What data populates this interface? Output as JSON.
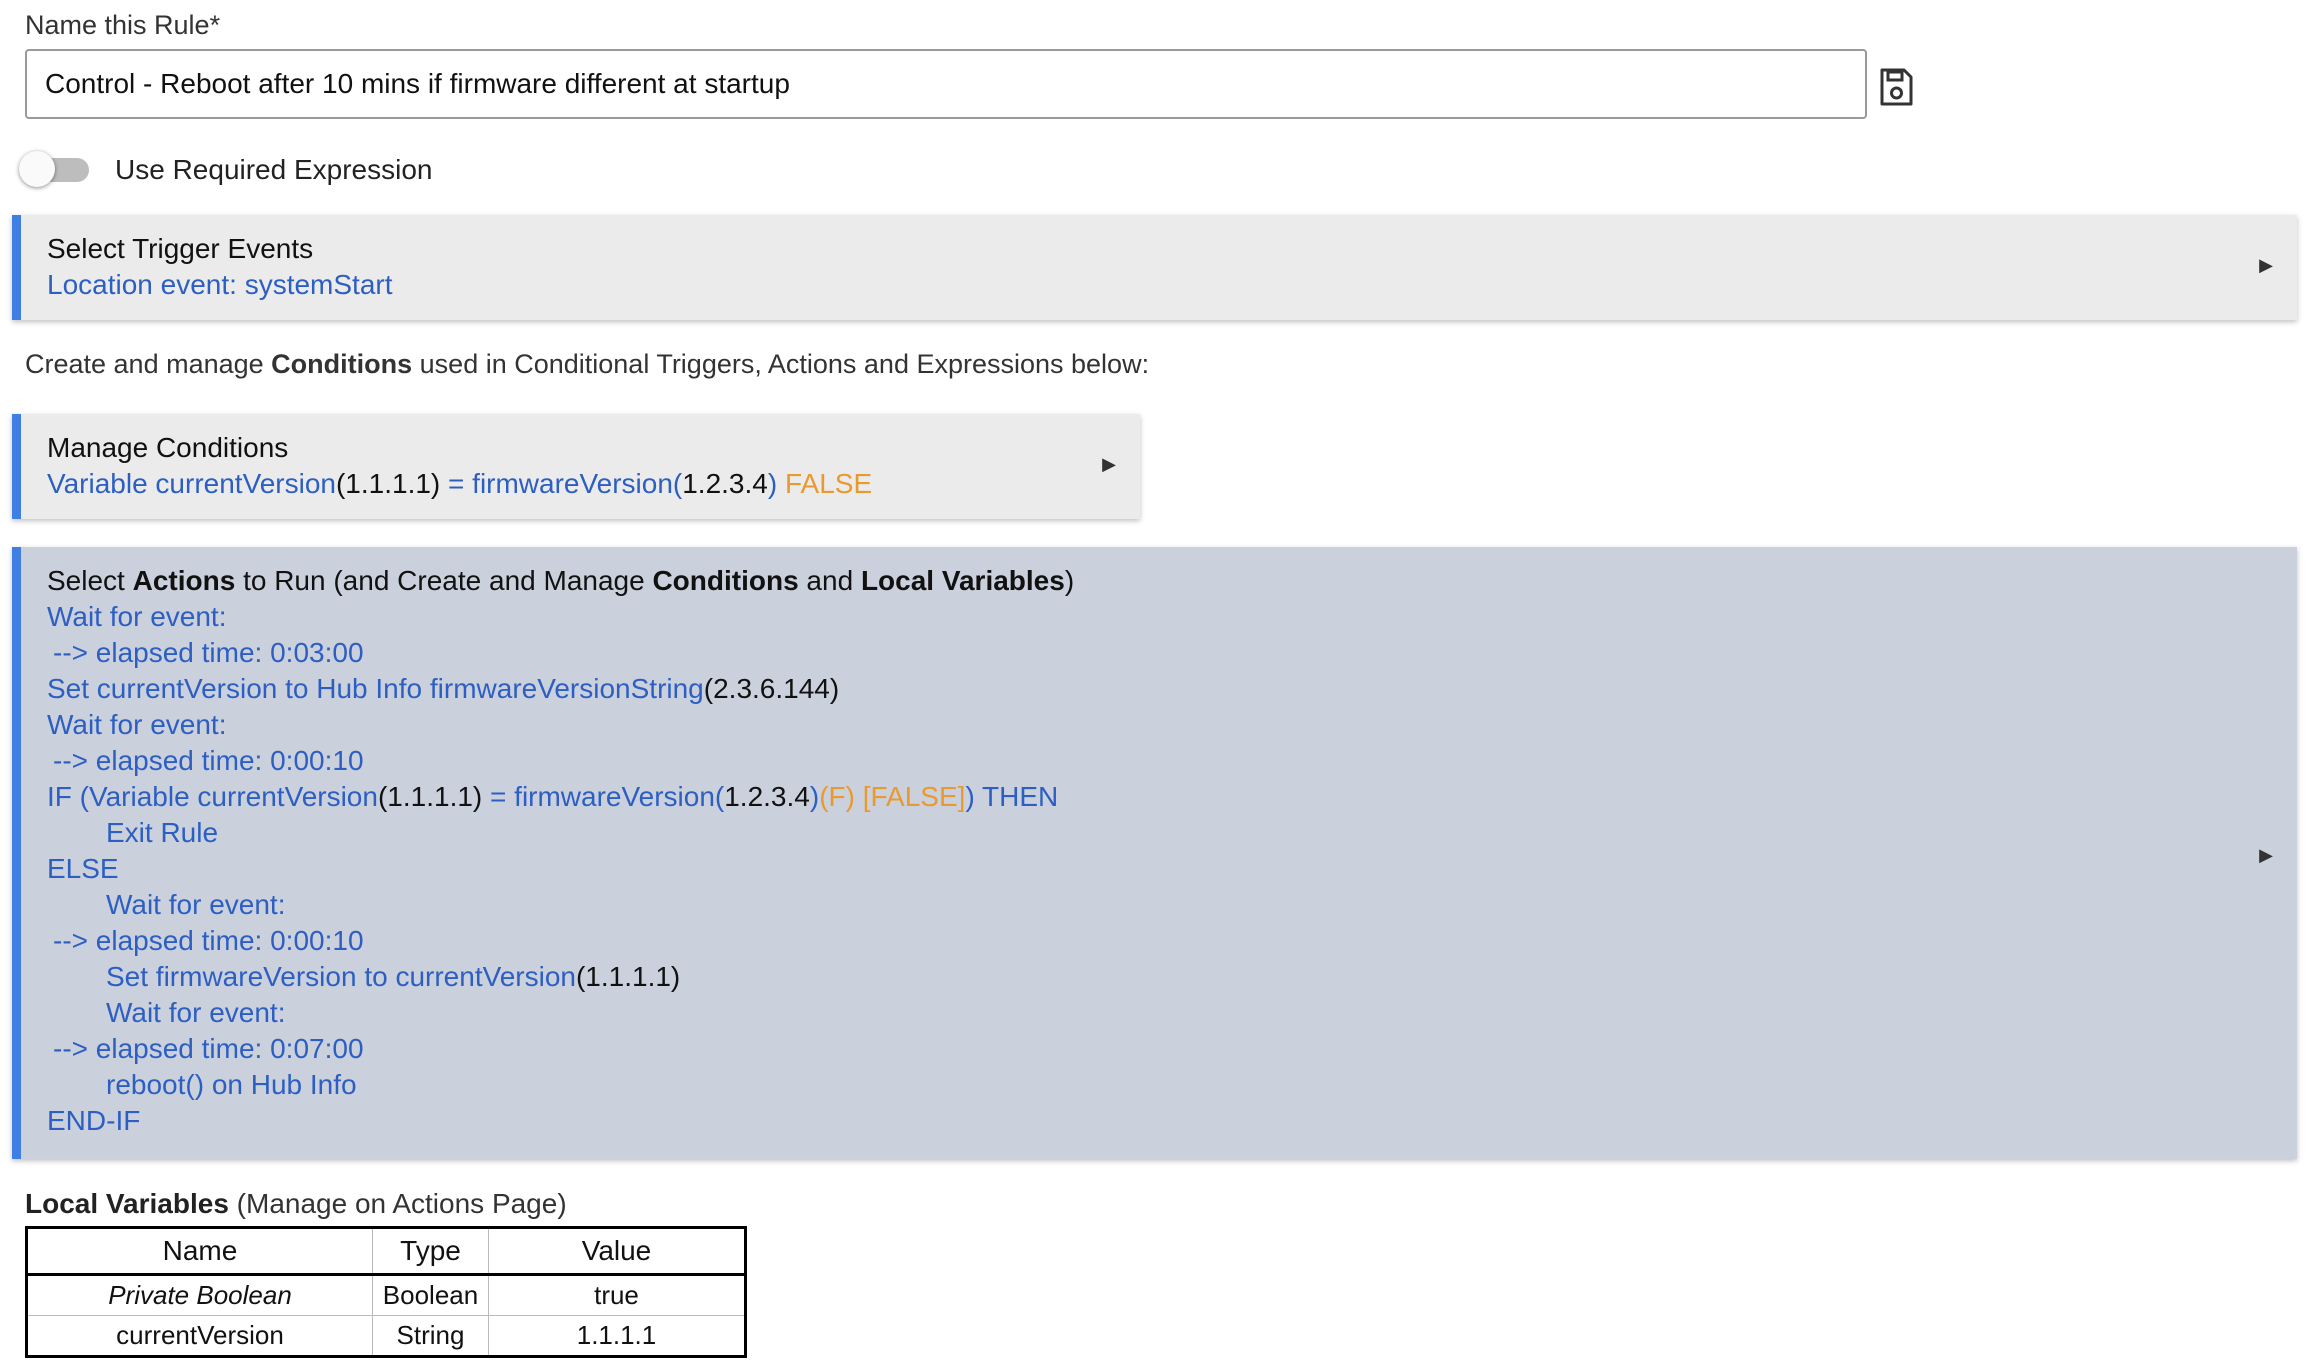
{
  "rule_name": {
    "label": "Name this Rule*",
    "value": "Control - Reboot after 10 mins if firmware different at startup"
  },
  "save_icon": "floppy-disk-icon",
  "required_expression": {
    "label": "Use Required Expression",
    "enabled": false
  },
  "trigger_panel": {
    "title": "Select Trigger Events",
    "summary": "Location event: systemStart",
    "arrow": "▶"
  },
  "conditions_intro": {
    "before": "Create and manage ",
    "bold": "Conditions",
    "after": " used in Conditional Triggers, Actions and Expressions below:"
  },
  "conditions_panel": {
    "title": "Manage Conditions",
    "line": {
      "a": "Variable currentVersion",
      "b": "(1.1.1.1)",
      "c": " = firmwareVersion(",
      "d": "1.2.3.4",
      "e": ")",
      "f": " FALSE"
    },
    "arrow": "▶"
  },
  "actions_panel": {
    "title": {
      "t1": "Select ",
      "b1": "Actions",
      "t2": " to Run (and Create and Manage ",
      "b2": "Conditions",
      "t3": " and ",
      "b3": "Local Variables",
      "t4": ")"
    },
    "arrow": "▶",
    "lines": {
      "wait1": "Wait for event:",
      "elapsed1": "--> elapsed time: 0:03:00",
      "set1_a": "Set currentVersion to Hub Info firmwareVersionString",
      "set1_b": "(2.3.6.144)",
      "wait2": "Wait for event:",
      "elapsed2": "--> elapsed time: 0:00:10",
      "if_a": "IF (Variable currentVersion",
      "if_b": "(1.1.1.1)",
      "if_c": " = firmwareVersion(",
      "if_d": "1.2.3.4",
      "if_e": ")",
      "if_f": "(F) [FALSE]",
      "if_g": ") THEN",
      "exit": "Exit Rule",
      "else": "ELSE",
      "wait3": "Wait for event:",
      "elapsed3": "--> elapsed time: 0:00:10",
      "set2_a": "Set firmwareVersion to currentVersion",
      "set2_b": "(1.1.1.1)",
      "wait4": "Wait for event:",
      "elapsed4": "--> elapsed time: 0:07:00",
      "reboot": "reboot() on Hub Info",
      "endif": "END-IF"
    }
  },
  "local_variables": {
    "title_bold": "Local Variables",
    "title_rest": " (Manage on Actions Page)",
    "columns": [
      "Name",
      "Type",
      "Value"
    ],
    "rows": [
      [
        "Private Boolean",
        "Boolean",
        "true"
      ],
      [
        "currentVersion",
        "String",
        "1.1.1.1"
      ]
    ]
  },
  "colors": {
    "accent_bar": "#3f7ee3",
    "link_blue": "#2d5fc2",
    "false_orange": "#e89a2f",
    "panel_light": "#ebebeb",
    "panel_actions": "#cbd0dd"
  }
}
